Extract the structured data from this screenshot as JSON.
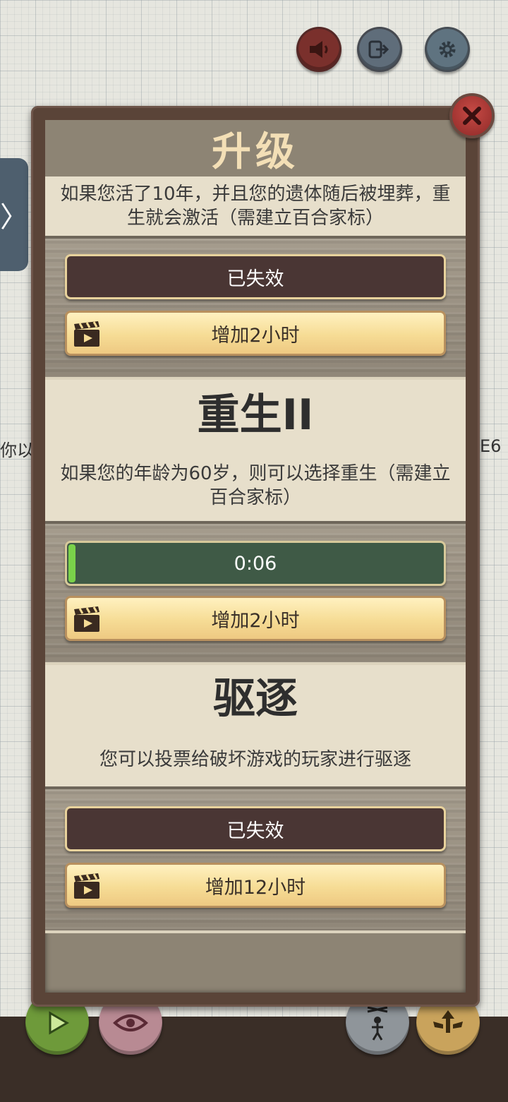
{
  "top_bar": {
    "sound_icon": "megaphone-icon",
    "exit_icon": "exit-icon",
    "settings_icon": "gear-icon"
  },
  "side_tab": {
    "glyph": "〉"
  },
  "background_text": {
    "left": "你以",
    "right": "E6"
  },
  "panel": {
    "title": "升级",
    "upgrades": [
      {
        "description": "如果您活了10年，并且您的遗体随后被埋葬，重生就会激活（需建立百合家标）",
        "status_label": "已失效",
        "add_time_label": "增加2小时"
      },
      {
        "name": "重生II",
        "description": "如果您的年龄为60岁，则可以选择重生（需建立百合家标）",
        "timer_label": "0:06",
        "timer_progress": 0.01,
        "add_time_label": "增加2小时"
      },
      {
        "name": "驱逐",
        "description": "您可以投票给破坏游戏的玩家进行驱逐",
        "status_label": "已失效",
        "add_time_label": "增加12小时"
      }
    ]
  },
  "bottom_bar": {
    "play_icon": "play-icon",
    "eye_icon": "eye-icon",
    "puppet_icon": "puppet-icon",
    "upgrade_icon": "winged-arrow-icon"
  },
  "colors": {
    "gold_button": "#f6dc95",
    "dark_button": "#4a3634",
    "progress_bar": "#3f5a46",
    "close_red": "#c74a45"
  }
}
